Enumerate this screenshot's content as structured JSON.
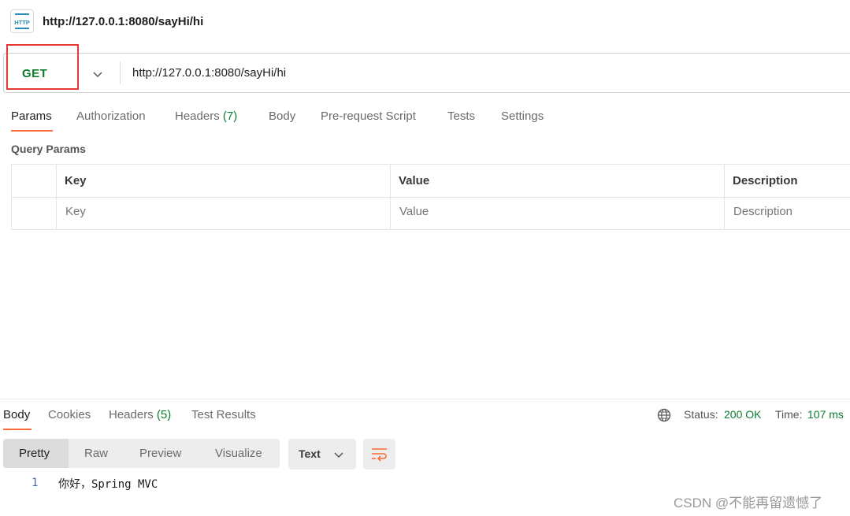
{
  "header": {
    "icon": "http-file-icon",
    "icon_text": "HTTP",
    "title": "http://127.0.0.1:8080/sayHi/hi"
  },
  "request": {
    "method": "GET",
    "url": "http://127.0.0.1:8080/sayHi/hi"
  },
  "request_tabs": [
    {
      "label": "Params"
    },
    {
      "label": "Authorization"
    },
    {
      "label": "Headers",
      "count": "(7)"
    },
    {
      "label": "Body"
    },
    {
      "label": "Pre-request Script"
    },
    {
      "label": "Tests"
    },
    {
      "label": "Settings"
    }
  ],
  "query_params": {
    "title": "Query Params",
    "columns": [
      "Key",
      "Value",
      "Description"
    ],
    "placeholders": {
      "key": "Key",
      "value": "Value",
      "description": "Description"
    }
  },
  "response": {
    "tabs": [
      {
        "label": "Body"
      },
      {
        "label": "Cookies"
      },
      {
        "label": "Headers",
        "count": "(5)"
      },
      {
        "label": "Test Results"
      }
    ],
    "status_label": "Status:",
    "status_value": "200 OK",
    "time_label": "Time:",
    "time_value": "107 ms",
    "view_modes": [
      "Pretty",
      "Raw",
      "Preview",
      "Visualize"
    ],
    "format": "Text",
    "body_lines": [
      {
        "num": "1",
        "text": "你好，Spring MVC"
      }
    ]
  },
  "watermark": "CSDN @不能再留遗憾了",
  "colors": {
    "accent": "#ff6c37",
    "method_get": "#0a7d2c",
    "highlight_box": "#e53935"
  }
}
